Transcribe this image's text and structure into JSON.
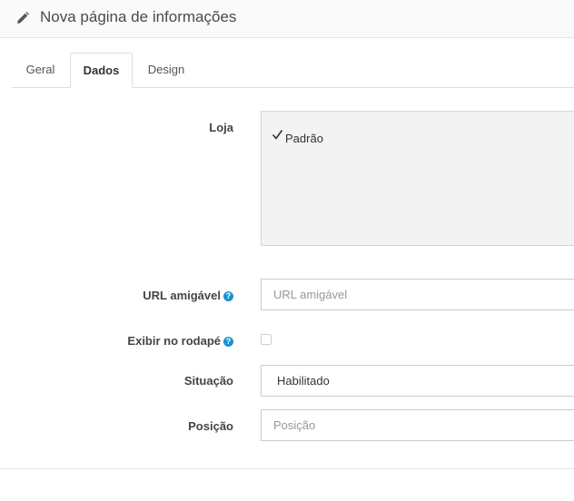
{
  "header": {
    "title": "Nova página de informações",
    "icon": "pencil-icon"
  },
  "tabs": [
    {
      "label": "Geral",
      "active": false
    },
    {
      "label": "Dados",
      "active": true
    },
    {
      "label": "Design",
      "active": false
    }
  ],
  "form": {
    "store": {
      "label": "Loja",
      "option": "Padrão",
      "checked": true
    },
    "seo_url": {
      "label": "URL amigável",
      "placeholder": "URL amigável",
      "value": ""
    },
    "bottom": {
      "label": "Exibir no rodapé",
      "checked": false
    },
    "status": {
      "label": "Situação",
      "value": "Habilitado"
    },
    "sort_order": {
      "label": "Posição",
      "placeholder": "Posição",
      "value": ""
    }
  },
  "help_glyph": "?",
  "colors": {
    "help": "#1e91cf",
    "store_box": "#f3f3f3"
  }
}
